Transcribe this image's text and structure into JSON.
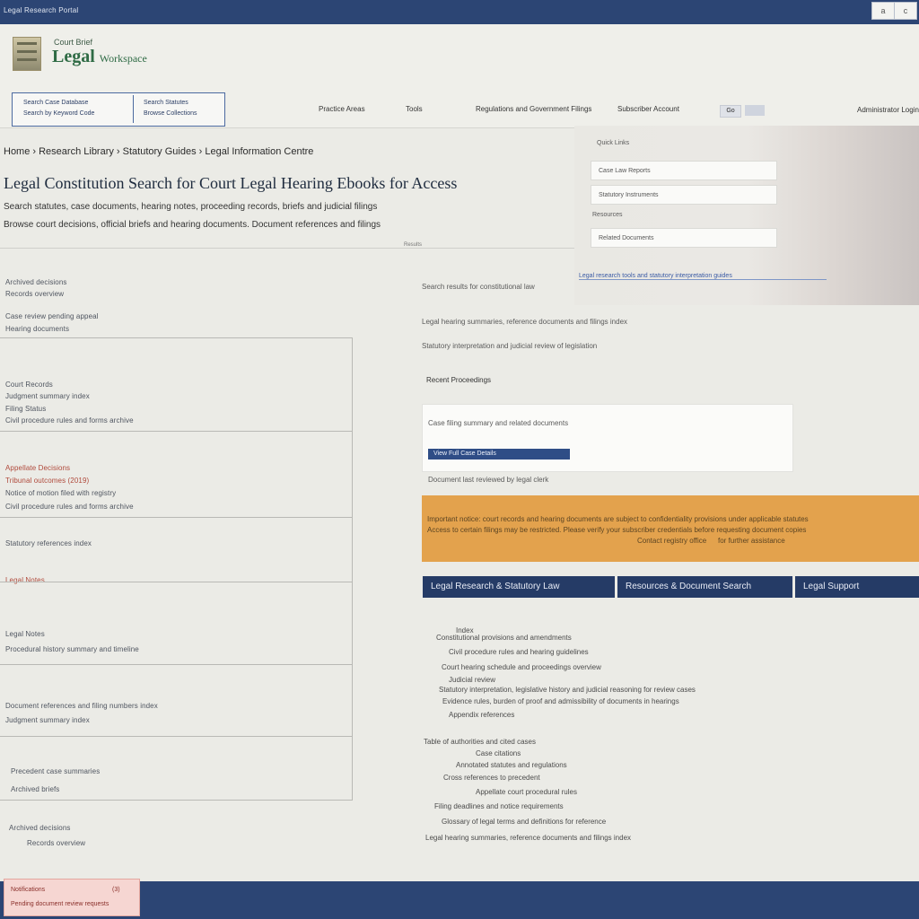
{
  "topbar": {
    "title": "Legal Research Portal",
    "btn_a": "a",
    "btn_b": "c"
  },
  "header": {
    "logo_sub": "Court Brief",
    "logo_title": "Legal",
    "logo_title_small": "Workspace"
  },
  "search": {
    "left_line1": "Search Case Database",
    "left_line2": "Search by Keyword Code",
    "right_line1": "Search Statutes",
    "right_line2": "Browse Collections"
  },
  "nav": {
    "link1": "Practice Areas",
    "link2": "Tools",
    "link3": "Regulations and Government Filings",
    "link4": "Subscriber Account",
    "mini_input": "Go",
    "account": "Administrator Login"
  },
  "page": {
    "breadcrumb": "Home › Research Library › Statutory Guides › Legal Information Centre",
    "title": "Legal Constitution Search for Court Legal Hearing Ebooks for Access",
    "subtitle_1": "Search statutes, case documents, hearing notes, proceeding records, briefs and judicial filings",
    "subtitle_2": "Browse court decisions, official briefs and hearing documents. Document references and filings",
    "mid_label": "Results"
  },
  "side": {
    "heading": "Quick Links",
    "item1": "Case Law Reports",
    "item2": "Statutory Instruments",
    "label2": "Resources",
    "item3": "Related Documents",
    "link": "Legal research tools and statutory interpretation guides"
  },
  "left_list": {
    "rows": [
      {
        "a": "Court Records",
        "b": "Judgment summary index",
        "c": "Case review pending appeal"
      },
      {
        "a": "Filing Status",
        "b": "Hearing documents",
        "c": "Civil procedure rules and forms archive"
      },
      {
        "a": "Appellate Decisions",
        "b": "Tribunal outcomes (2019)",
        "c": "Notice of motion filed with registry"
      },
      {
        "a": "Statutory references index"
      },
      {
        "a": "Legal Notes",
        "b": "Procedural history summary and timeline"
      },
      {
        "a": "Document references and filing numbers index"
      },
      {
        "a": "Precedent case summaries",
        "b": "Archived briefs"
      }
    ],
    "tail_a": "Archived decisions",
    "tail_b": "Records overview"
  },
  "right": {
    "line1": "Search results for constitutional law",
    "line2": "Legal hearing summaries, reference documents and filings index",
    "line3": "Statutory interpretation and judicial review of legislation",
    "section": "Recent Proceedings",
    "card_line": "Case filing summary and related documents",
    "pill": "View Full Case Details",
    "card_foot": "Document last reviewed by legal clerk"
  },
  "banner": {
    "line1": "Important notice: court records and hearing documents are subject to confidentiality provisions under applicable statutes",
    "line2": "Access to certain filings may be restricted. Please verify your subscriber credentials before requesting document copies",
    "line3": "Contact registry office",
    "line4": "for further assistance"
  },
  "tabs": [
    {
      "label": "Legal Research & Statutory Law"
    },
    {
      "label": "Resources & Document Search"
    },
    {
      "label": "Legal Support"
    }
  ],
  "tree": {
    "l1": "Index",
    "l2": "Constitutional provisions and amendments",
    "l3": "Civil procedure rules and hearing guidelines",
    "l4": "Court hearing schedule and proceedings overview",
    "l5": "Judicial review",
    "l6": "Statutory interpretation, legislative history and judicial reasoning for review cases",
    "l7": "Evidence rules, burden of proof and admissibility of documents in hearings",
    "l8": "Appendix references",
    "l9": "Table of authorities and cited cases",
    "l10": "Case citations",
    "l11": "Annotated statutes and regulations",
    "l12": "Cross references to precedent",
    "l13": "Appellate court procedural rules",
    "l14": "Filing deadlines and notice requirements",
    "l15": "Glossary of legal terms and definitions for reference"
  },
  "alert": {
    "title": "Notifications",
    "count": "(3)",
    "msg": "Pending document review requests"
  },
  "colors": {
    "navy": "#2c4574",
    "orange": "#e3a24d",
    "green": "#2f6b45"
  }
}
